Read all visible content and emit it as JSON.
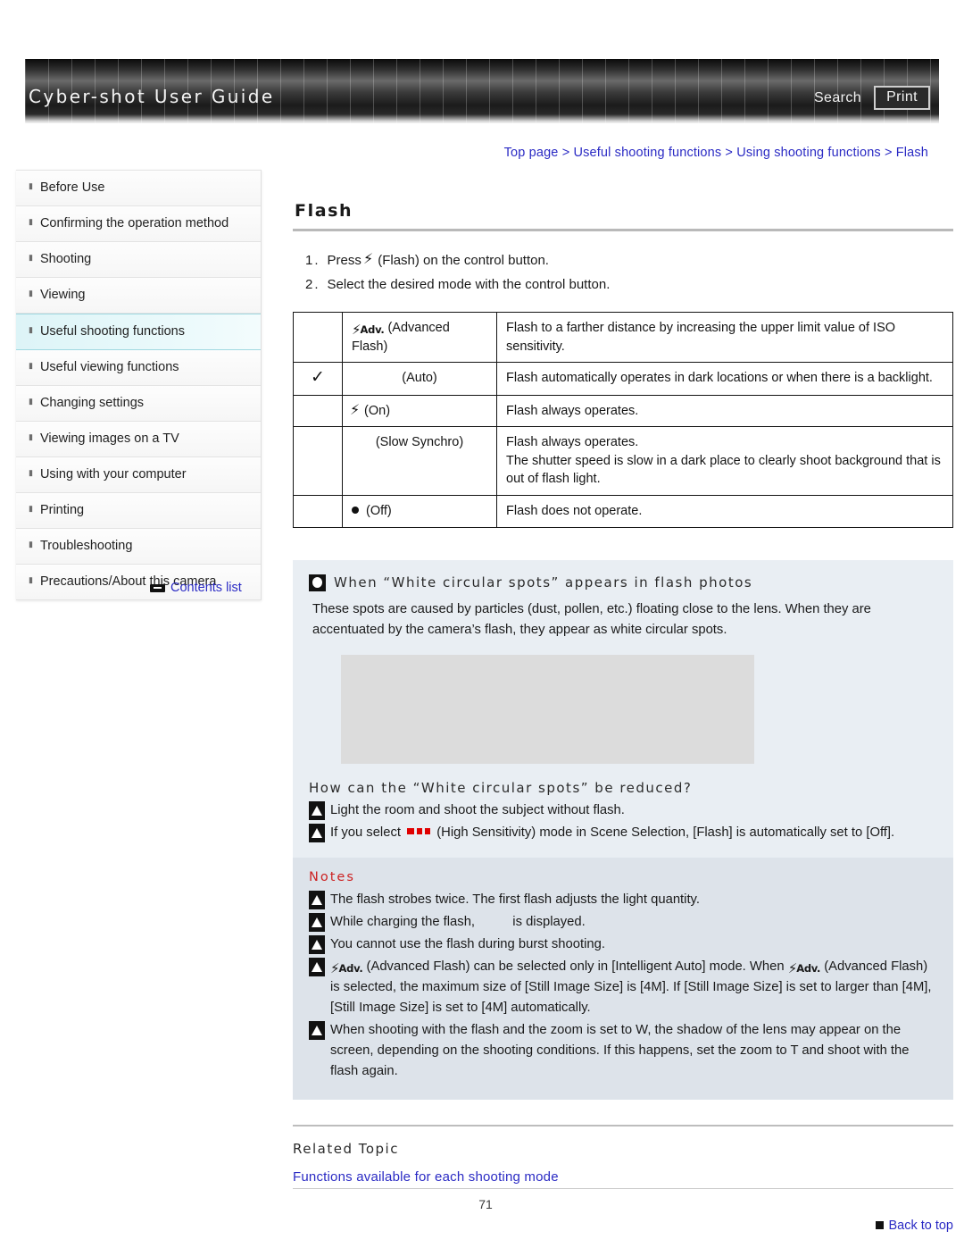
{
  "header": {
    "title": "Cyber-shot User Guide",
    "search_label": "Search",
    "print_label": "Print"
  },
  "breadcrumb": "Top page > Useful shooting functions > Using shooting functions > Flash",
  "sidebar": {
    "items": [
      {
        "label": "Before Use",
        "active": false
      },
      {
        "label": "Confirming the operation method",
        "active": false
      },
      {
        "label": "Shooting",
        "active": false
      },
      {
        "label": "Viewing",
        "active": false
      },
      {
        "label": "Useful shooting functions",
        "active": true
      },
      {
        "label": "Useful viewing functions",
        "active": false
      },
      {
        "label": "Changing settings",
        "active": false
      },
      {
        "label": "Viewing images on a TV",
        "active": false
      },
      {
        "label": "Using with your computer",
        "active": false
      },
      {
        "label": "Printing",
        "active": false
      },
      {
        "label": "Troubleshooting",
        "active": false
      },
      {
        "label": "Precautions/About this camera",
        "active": false
      }
    ],
    "contents_list_label": "Contents list"
  },
  "main": {
    "title": "Flash",
    "steps": [
      {
        "num": "1.",
        "pre": "Press",
        "icon": "flash-icon",
        "post": "(Flash) on the control button."
      },
      {
        "num": "2.",
        "pre": "Select the desired mode with the control button.",
        "icon": "",
        "post": ""
      }
    ],
    "table": {
      "rows": [
        {
          "checked": false,
          "icon": "advanced-flash-icon",
          "mode": "(Advanced Flash)",
          "align": "left",
          "desc": "Flash to a farther distance by increasing the upper limit value of ISO sensitivity."
        },
        {
          "checked": true,
          "icon": "",
          "mode": "(Auto)",
          "align": "center",
          "desc": "Flash automatically operates in dark locations or when there is a backlight."
        },
        {
          "checked": false,
          "icon": "flash-icon",
          "mode": "(On)",
          "align": "left",
          "desc": "Flash always operates."
        },
        {
          "checked": false,
          "icon": "",
          "mode": "(Slow Synchro)",
          "align": "center",
          "desc": "Flash always operates.\nThe shutter speed is slow in a dark place to clearly shoot background that is out of flash light."
        },
        {
          "checked": false,
          "icon": "dot-icon",
          "mode": "(Off)",
          "align": "left",
          "desc": "Flash does not operate."
        }
      ]
    },
    "info_panel": {
      "heading": "When “White circular spots” appears in flash photos",
      "body": "These spots are caused by particles (dust, pollen, etc.) floating close to the lens. When they are accentuated by the camera’s flash, they appear as white circular spots.",
      "sub_heading": "How can the “White circular spots” be reduced?",
      "tips": [
        {
          "pre": "Light the room and shoot the subject without flash.",
          "icon": "",
          "post": ""
        },
        {
          "pre": "If you select",
          "icon": "high-sensitivity-icon",
          "post": "(High Sensitivity) mode in Scene Selection, [Flash] is automatically set to [Off]."
        }
      ]
    },
    "notes": {
      "heading": "Notes",
      "items": [
        {
          "pre": "The flash strobes twice. The first flash adjusts the light quantity.",
          "icon": "",
          "post": ""
        },
        {
          "pre": "While charging the flash,",
          "icon": "charging-icon",
          "post": "is displayed."
        },
        {
          "pre": "You cannot use the flash during burst shooting.",
          "icon": "",
          "post": ""
        },
        {
          "pre": "",
          "icon": "advanced-flash-icon",
          "post": "(Advanced Flash) can be selected only in [Intelligent Auto] mode. When",
          "icon2": "advanced-flash-icon",
          "post2": "(Advanced Flash) is selected, the maximum size of [Still Image Size] is [4M]. If [Still Image Size] is set to larger than [4M], [Still Image Size] is set to [4M] automatically."
        },
        {
          "pre": "When shooting with the flash and the zoom is set to W, the shadow of the lens may appear on the screen, depending on the shooting conditions. If this happens, set the zoom to T and shoot with the flash again.",
          "icon": "",
          "post": ""
        }
      ]
    },
    "related": {
      "heading": "Related Topic",
      "link": "Functions available for each shooting mode"
    },
    "back_to_top": "Back to top",
    "page_number": "71"
  },
  "colors": {
    "link": "#2b2bc4",
    "notes_heading": "#cc2222",
    "info_panel_bg": "#e9eef3",
    "notes_panel_bg": "#dde3ea",
    "active_nav": "#ddf4f7"
  }
}
